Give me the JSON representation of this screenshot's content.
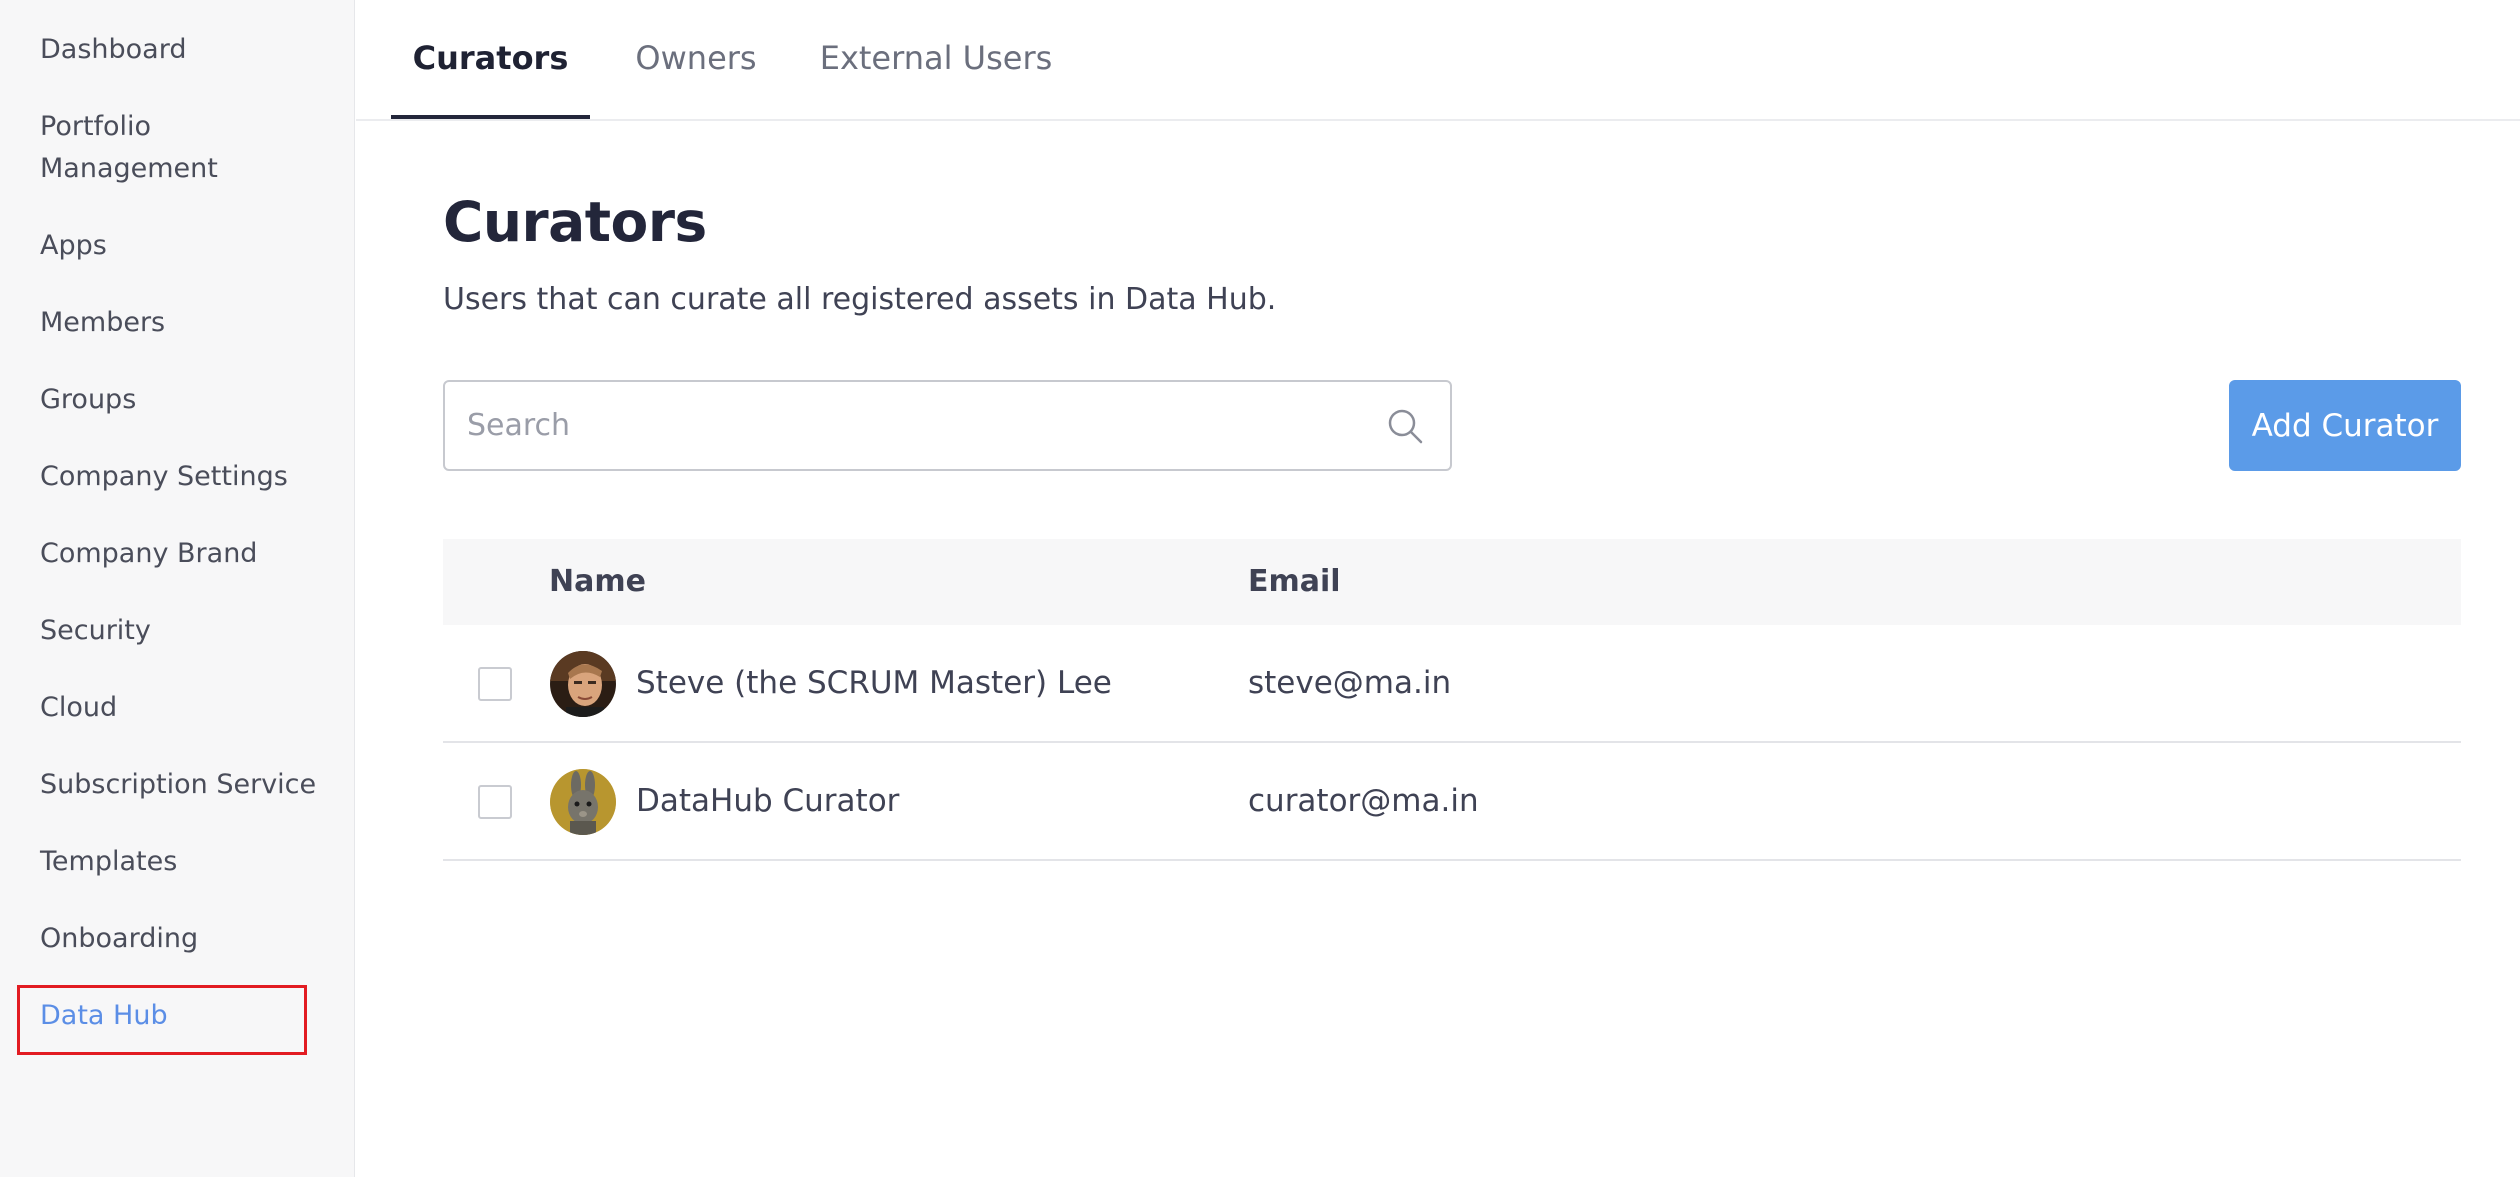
{
  "sidebar": {
    "items": [
      {
        "label": "Dashboard"
      },
      {
        "label": "Portfolio Management"
      },
      {
        "label": "Apps"
      },
      {
        "label": "Members"
      },
      {
        "label": "Groups"
      },
      {
        "label": "Company Settings"
      },
      {
        "label": "Company Brand"
      },
      {
        "label": "Security"
      },
      {
        "label": "Cloud"
      },
      {
        "label": "Subscription Service"
      },
      {
        "label": "Templates"
      },
      {
        "label": "Onboarding"
      },
      {
        "label": "Data Hub"
      }
    ],
    "active": "Data Hub"
  },
  "tabs": [
    {
      "label": "Curators",
      "active": true
    },
    {
      "label": "Owners",
      "active": false
    },
    {
      "label": "External Users",
      "active": false
    }
  ],
  "main": {
    "title": "Curators",
    "description": "Users that can curate all registered assets in Data Hub.",
    "search": {
      "placeholder": "Search",
      "value": "",
      "icon": "search-icon"
    },
    "add_button_label": "Add Curator"
  },
  "table": {
    "columns": [
      "Name",
      "Email"
    ],
    "rows": [
      {
        "name": "Steve (the SCRUM Master) Lee",
        "email": "steve@ma.in",
        "avatar": "person-photo",
        "checked": false
      },
      {
        "name": "DataHub Curator",
        "email": "curator@ma.in",
        "avatar": "rabbit-photo",
        "checked": false
      }
    ]
  },
  "colors": {
    "accent": "#5b9be8",
    "active_nav": "#5b8ee6",
    "highlight": "#e21c22"
  }
}
